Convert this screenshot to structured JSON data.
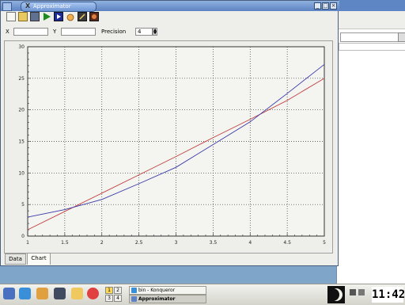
{
  "window": {
    "title": "Approximator",
    "logo": "X",
    "buttons": [
      "_",
      "□",
      "×"
    ]
  },
  "toolbar": {
    "icons": [
      "new-icon",
      "open-icon",
      "save-icon",
      "run-icon",
      "step-icon",
      "hand-icon",
      "edit-icon",
      "exit-icon"
    ]
  },
  "inputs": {
    "x_label": "X",
    "x_value": "",
    "y_label": "Y",
    "y_value": "",
    "precision_label": "Precision",
    "precision_value": "4"
  },
  "tabs": [
    {
      "label": "Data",
      "active": false
    },
    {
      "label": "Chart",
      "active": true
    }
  ],
  "chart_data": {
    "type": "line",
    "title": "",
    "xlabel": "",
    "ylabel": "",
    "xlim": [
      1,
      5
    ],
    "ylim": [
      0,
      30
    ],
    "grid": true,
    "x_ticks": [
      1,
      1.5,
      2,
      2.5,
      3,
      3.5,
      4,
      4.5,
      5
    ],
    "x_tick_labels": [
      "1",
      "1.5",
      "2",
      "2.5",
      "3",
      "3.5",
      "4",
      "4.5",
      "5"
    ],
    "y_ticks": [
      0,
      5,
      10,
      15,
      20,
      25,
      30
    ],
    "y_tick_labels": [
      "0",
      "5",
      "10",
      "15",
      "20",
      "25",
      "30"
    ],
    "series": [
      {
        "color": "#c04040",
        "x": [
          1,
          1.5,
          2,
          2.5,
          3,
          3.5,
          4,
          4.5,
          5
        ],
        "y": [
          1,
          3.9,
          6.8,
          9.7,
          12.6,
          15.6,
          18.5,
          21.5,
          25
        ]
      },
      {
        "color": "#3a3aa8",
        "x": [
          1,
          1.5,
          2,
          2.5,
          3,
          3.5,
          4,
          4.5,
          5
        ],
        "y": [
          3,
          4.2,
          5.8,
          8.3,
          10.9,
          14.5,
          18.1,
          22.6,
          27.2
        ]
      }
    ]
  },
  "taskbar": {
    "pager": [
      "1",
      "2",
      "3",
      "4"
    ],
    "tasks": [
      {
        "label": "bin - Konqueror",
        "active": false
      },
      {
        "label": "Approximator",
        "active": true
      }
    ],
    "clock": "11:42",
    "icons": [
      "kde-menu-icon",
      "konqueror-icon",
      "home-icon",
      "shell-icon",
      "help-icon",
      "lifebuoy-icon"
    ]
  }
}
